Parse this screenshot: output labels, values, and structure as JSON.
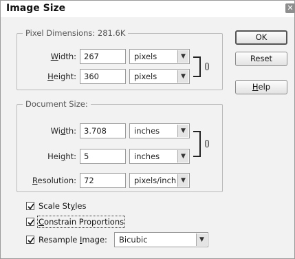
{
  "dialog": {
    "title": "Image Size",
    "close_glyph": "✕"
  },
  "pixel_dimensions": {
    "legend": "Pixel Dimensions:  281.6K",
    "width_label_pre": "",
    "width_label_key": "W",
    "width_label_post": "idth:",
    "width_value": "267",
    "width_unit": "pixels",
    "height_label_pre": "",
    "height_label_key": "H",
    "height_label_post": "eight:",
    "height_value": "360",
    "height_unit": "pixels"
  },
  "document_size": {
    "legend": "Document Size:",
    "width_label_pre": "Wi",
    "width_label_key": "d",
    "width_label_post": "th:",
    "width_value": "3.708",
    "width_unit": "inches",
    "height_label_pre": "Hei",
    "height_label_key": "g",
    "height_label_post": "ht:",
    "height_value": "5",
    "height_unit": "inches",
    "resolution_label_pre": "",
    "resolution_label_key": "R",
    "resolution_label_post": "esolution:",
    "resolution_value": "72",
    "resolution_unit": "pixels/inch"
  },
  "buttons": {
    "ok": "OK",
    "reset": "Reset",
    "help_pre": "",
    "help_key": "H",
    "help_post": "elp"
  },
  "options": {
    "scale_styles": {
      "label_pre": "Scale St",
      "label_key": "y",
      "label_post": "les",
      "checked": true
    },
    "constrain": {
      "label_pre": "",
      "label_key": "C",
      "label_post": "onstrain Proportions",
      "checked": true
    },
    "resample": {
      "label_pre": "Resample ",
      "label_key": "I",
      "label_post": "mage:",
      "checked": true,
      "method": "Bicubic"
    }
  },
  "icons": {
    "dropdown": "chevron-down-icon",
    "link": "chain-link-icon",
    "check": "checkmark-icon"
  }
}
